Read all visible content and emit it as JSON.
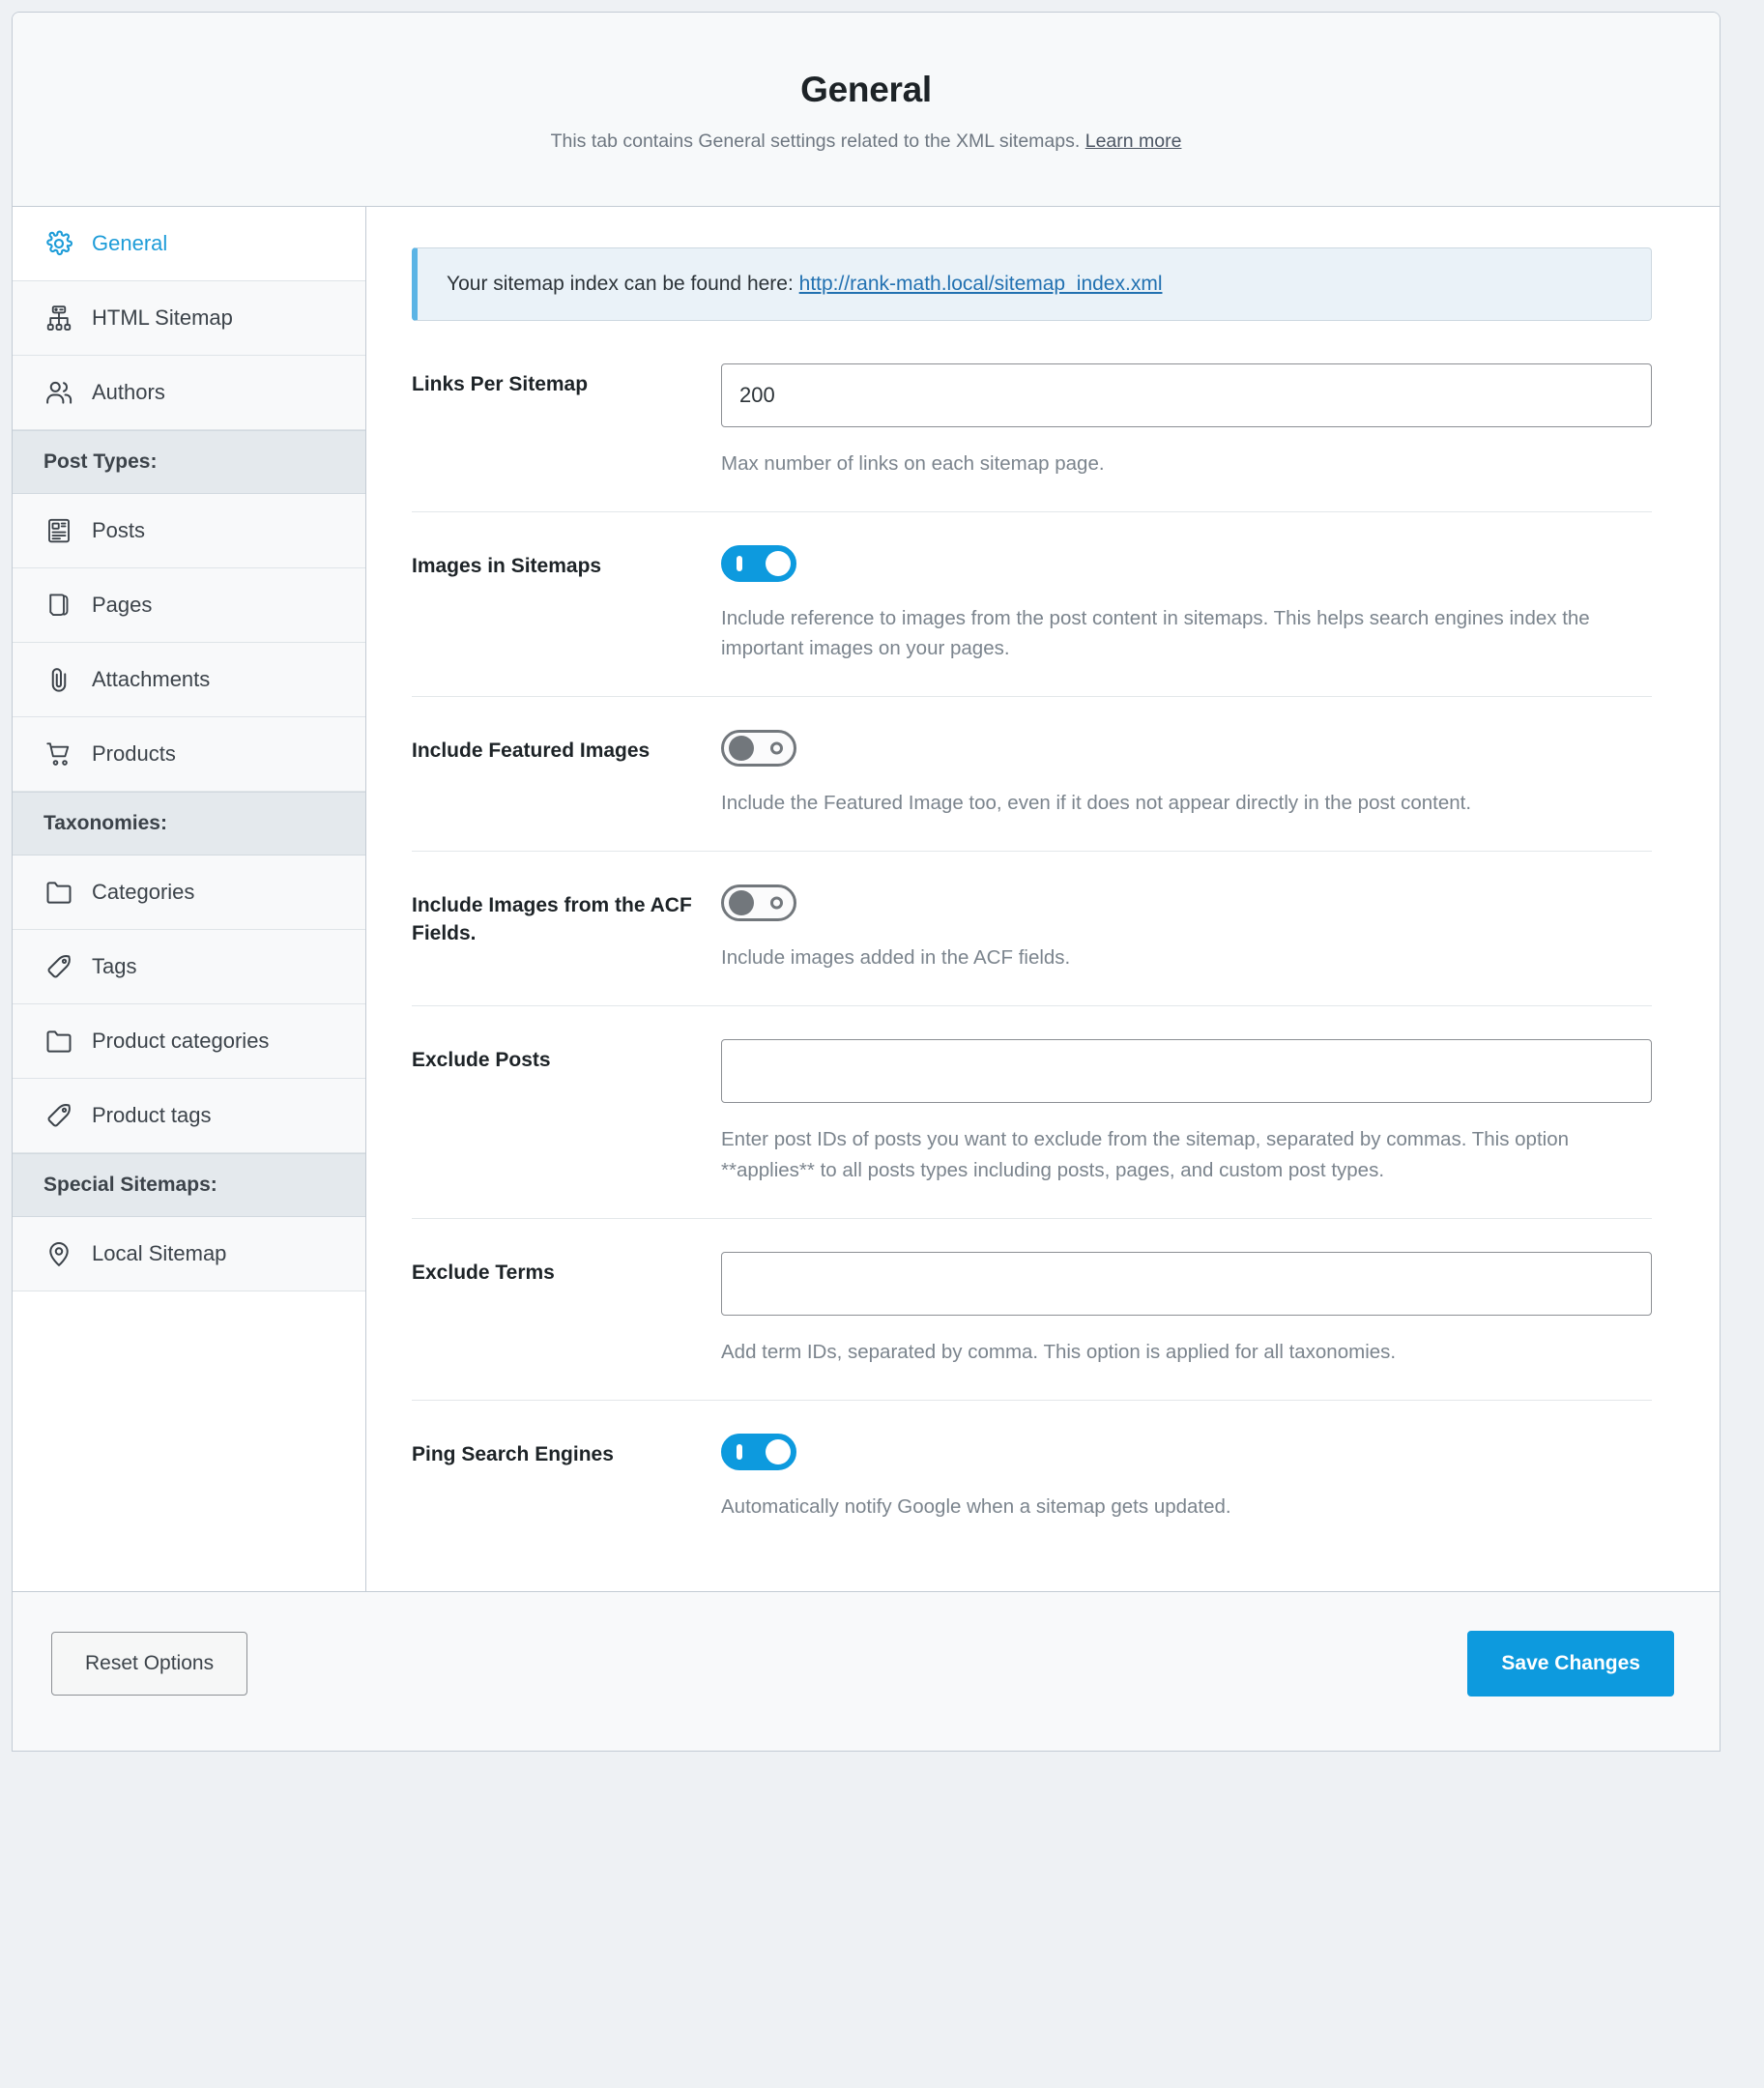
{
  "header": {
    "title": "General",
    "subtitle": "This tab contains General settings related to the XML sitemaps.",
    "learn_more": "Learn more"
  },
  "sidebar": {
    "items": [
      {
        "label": "General",
        "icon": "gear-icon",
        "type": "item",
        "active": true
      },
      {
        "label": "HTML Sitemap",
        "icon": "sitemap-icon",
        "type": "item",
        "active": false
      },
      {
        "label": "Authors",
        "icon": "users-icon",
        "type": "item",
        "active": false
      },
      {
        "label": "Post Types:",
        "icon": "",
        "type": "heading",
        "active": false
      },
      {
        "label": "Posts",
        "icon": "document-icon",
        "type": "item",
        "active": false
      },
      {
        "label": "Pages",
        "icon": "page-icon",
        "type": "item",
        "active": false
      },
      {
        "label": "Attachments",
        "icon": "paperclip-icon",
        "type": "item",
        "active": false
      },
      {
        "label": "Products",
        "icon": "cart-icon",
        "type": "item",
        "active": false
      },
      {
        "label": "Taxonomies:",
        "icon": "",
        "type": "heading",
        "active": false
      },
      {
        "label": "Categories",
        "icon": "folder-icon",
        "type": "item",
        "active": false
      },
      {
        "label": "Tags",
        "icon": "tag-icon",
        "type": "item",
        "active": false
      },
      {
        "label": "Product categories",
        "icon": "folder-icon",
        "type": "item",
        "active": false
      },
      {
        "label": "Product tags",
        "icon": "tag-icon",
        "type": "item",
        "active": false
      },
      {
        "label": "Special Sitemaps:",
        "icon": "",
        "type": "heading",
        "active": false
      },
      {
        "label": "Local Sitemap",
        "icon": "map-pin-icon",
        "type": "item",
        "active": false
      }
    ]
  },
  "notice": {
    "text": "Your sitemap index can be found here:",
    "link": "http://rank-math.local/sitemap_index.xml"
  },
  "fields": [
    {
      "label": "Links Per Sitemap",
      "control": "text",
      "value": "200",
      "placeholder": "",
      "help": "Max number of links on each sitemap page."
    },
    {
      "label": "Images in Sitemaps",
      "control": "toggle",
      "value": "on",
      "help": "Include reference to images from the post content in sitemaps. This helps search engines index the important images on your pages."
    },
    {
      "label": "Include Featured Images",
      "control": "toggle",
      "value": "off",
      "help": "Include the Featured Image too, even if it does not appear directly in the post content."
    },
    {
      "label": "Include Images from the ACF Fields.",
      "control": "toggle",
      "value": "off",
      "help": "Include images added in the ACF fields."
    },
    {
      "label": "Exclude Posts",
      "control": "text",
      "value": "",
      "placeholder": "",
      "help": "Enter post IDs of posts you want to exclude from the sitemap, separated by commas. This option **applies** to all posts types including posts, pages, and custom post types."
    },
    {
      "label": "Exclude Terms",
      "control": "text",
      "value": "",
      "placeholder": "",
      "help": "Add term IDs, separated by comma. This option is applied for all taxonomies."
    },
    {
      "label": "Ping Search Engines",
      "control": "toggle",
      "value": "on",
      "help": "Automatically notify Google when a sitemap gets updated."
    }
  ],
  "footer": {
    "reset_label": "Reset Options",
    "save_label": "Save Changes"
  },
  "colors": {
    "accent": "#0d9ade",
    "link": "#2271b1",
    "notice_bg": "#eaf2f8",
    "notice_border": "#5bb4e5",
    "page_bg": "#eef1f4"
  }
}
